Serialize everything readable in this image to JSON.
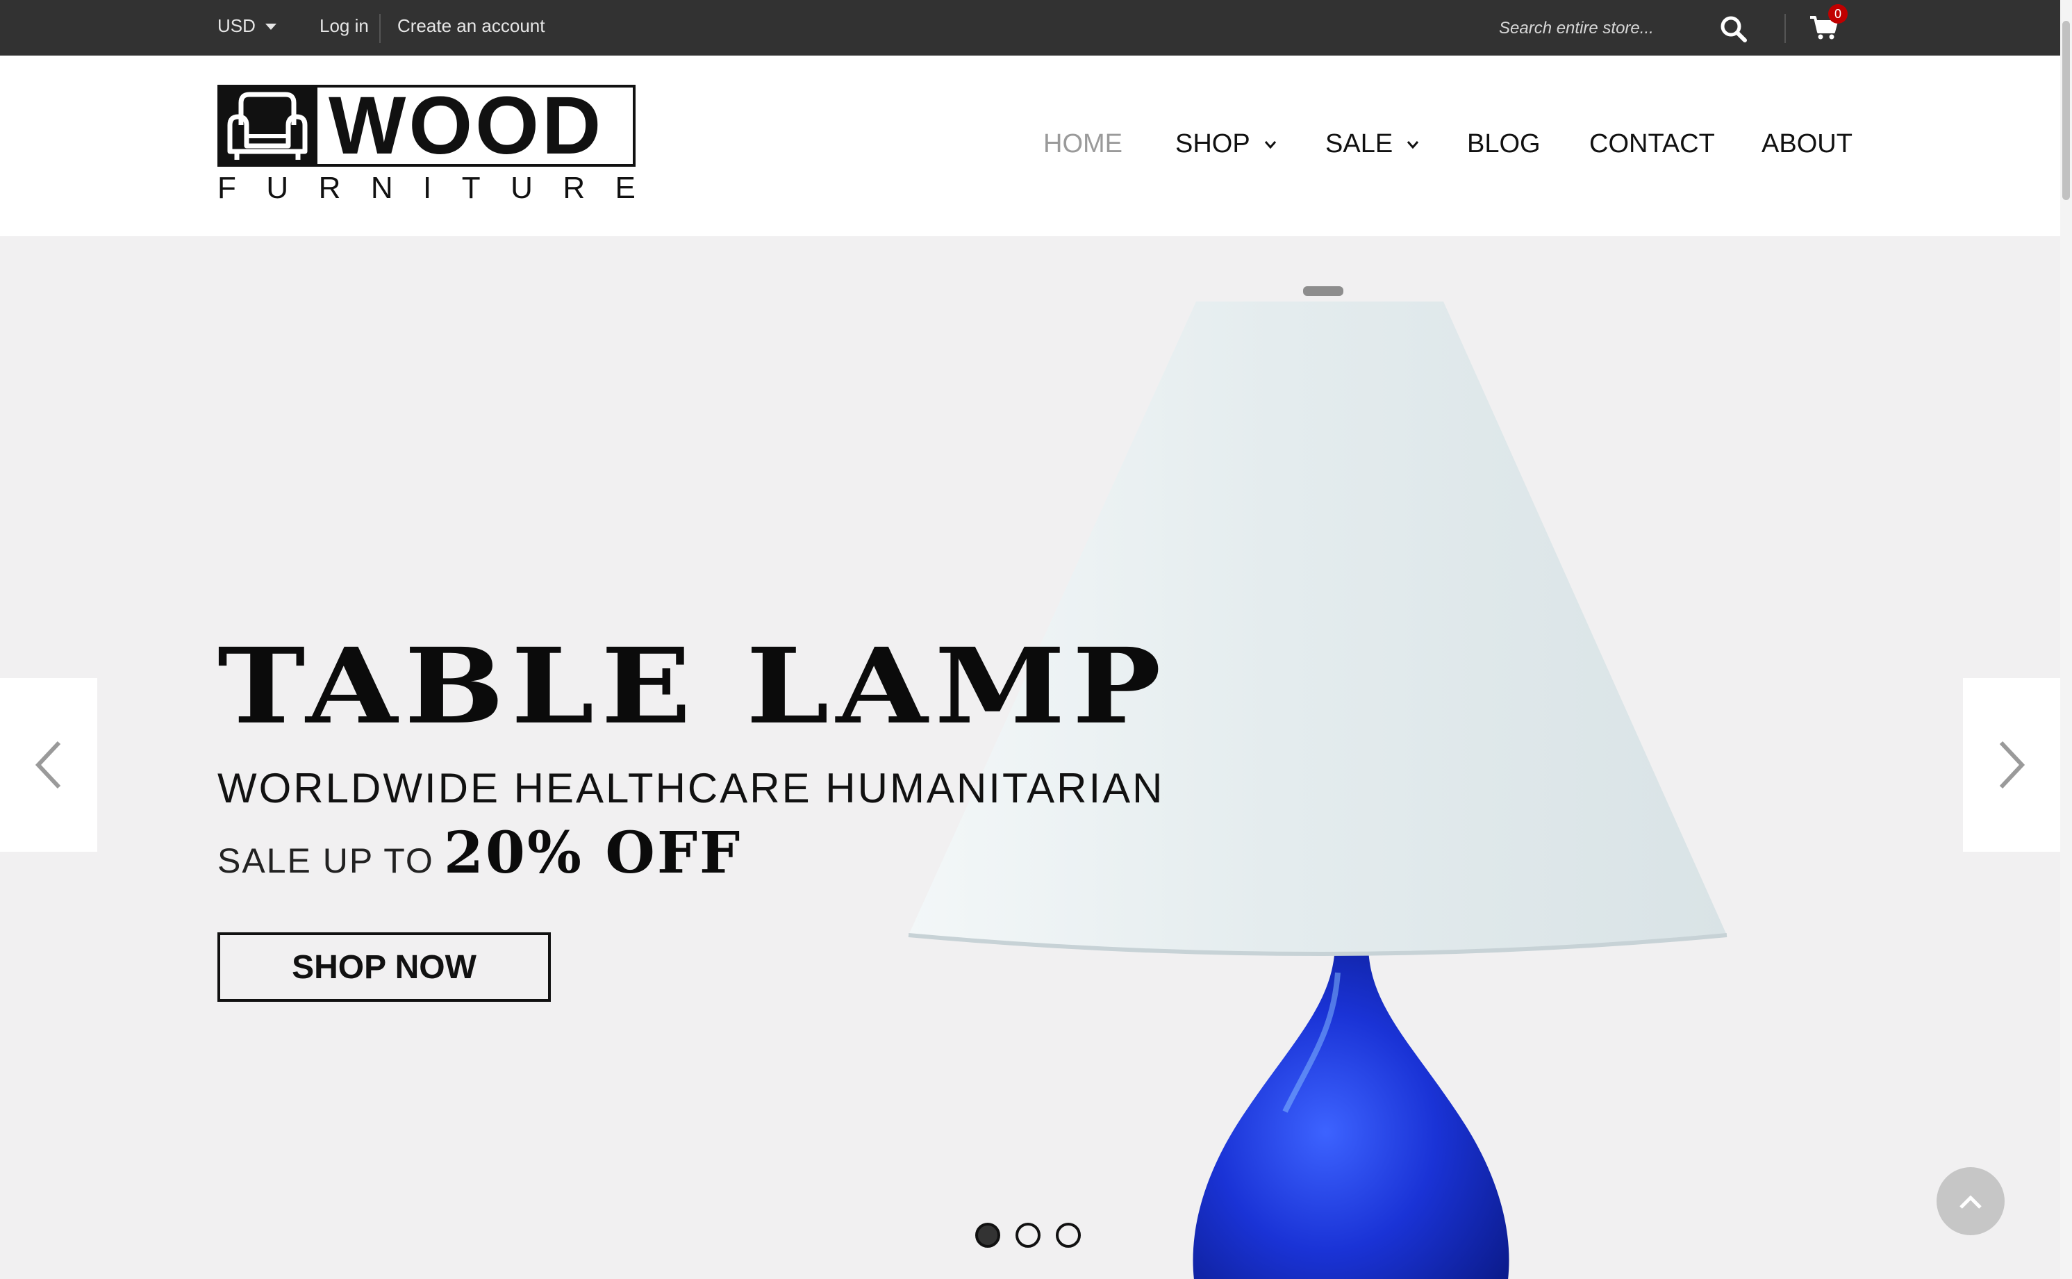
{
  "topbar": {
    "currency": "USD",
    "login": "Log in",
    "create_account": "Create an account",
    "search_placeholder": "Search entire store...",
    "cart_count": "0"
  },
  "header": {
    "logo_word": "WOOD",
    "logo_sub": [
      "F",
      "U",
      "R",
      "N",
      "I",
      "T",
      "U",
      "R",
      "E"
    ],
    "nav": [
      {
        "label": "HOME",
        "active": true
      },
      {
        "label": "SHOP",
        "dropdown": true
      },
      {
        "label": "SALE",
        "dropdown": true
      },
      {
        "label": "BLOG"
      },
      {
        "label": "CONTACT"
      },
      {
        "label": "ABOUT"
      }
    ]
  },
  "hero": {
    "title": "TABLE LAMP",
    "subtitle": "WORLDWIDE HEALTHCARE HUMANITARIAN",
    "sale_prefix": "SALE UP TO",
    "sale_amount": "20% OFF",
    "button": "SHOP NOW",
    "slides_total": 3,
    "active_slide": 1
  },
  "colors": {
    "topbar_bg": "#323232",
    "hero_bg": "#f1f0f1",
    "lampshade": "#e3ebee",
    "lamp_base": "#1a33d6",
    "badge": "#c00000"
  }
}
